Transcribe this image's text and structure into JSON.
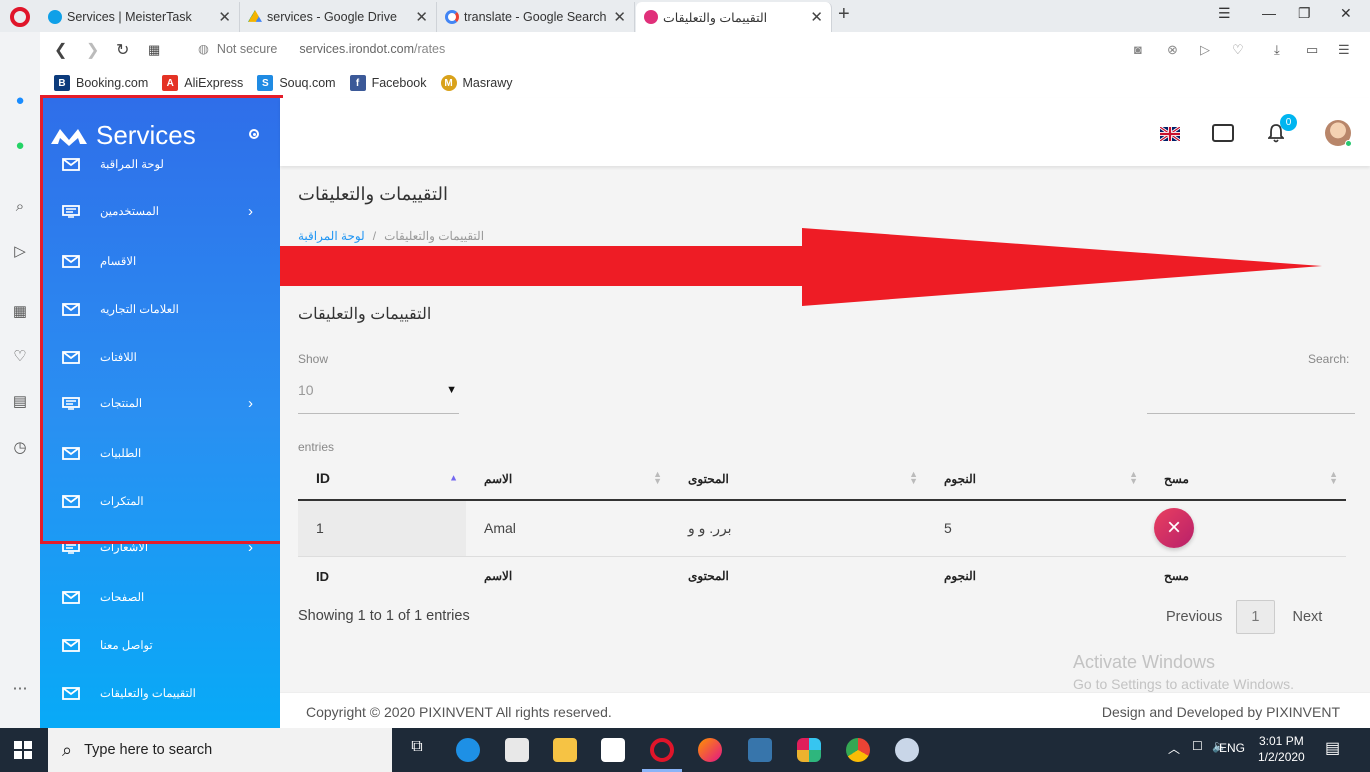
{
  "browser": {
    "tabs": [
      {
        "title": "Services | MeisterTask",
        "color": "#0fa0e8"
      },
      {
        "title": "services - Google Drive",
        "color": "#f4b400"
      },
      {
        "title": "translate - Google Search",
        "color": "#4285f4"
      },
      {
        "title": "التقييمات والتعليقات",
        "color": "#e0307a"
      }
    ],
    "not_secure": "Not secure",
    "url_host": "services.irondot.com",
    "url_path": "/rates",
    "bookmarks": [
      {
        "label": "Booking.com",
        "icon": "B",
        "color": "#0c3b7c"
      },
      {
        "label": "AliExpress",
        "icon": "A",
        "color": "#e43225"
      },
      {
        "label": "Souq.com",
        "icon": "S",
        "color": "#1f8be3"
      },
      {
        "label": "Facebook",
        "icon": "f",
        "color": "#3b5998"
      },
      {
        "label": "Masrawy",
        "icon": "M",
        "color": "#d9a21b"
      }
    ]
  },
  "sidebar": {
    "brand": "Services",
    "items": [
      {
        "label": "لوحة المراقبة",
        "icon": "mail-icon",
        "has_arrow": false
      },
      {
        "label": "المستخدمين",
        "icon": "monitor-icon",
        "has_arrow": true
      },
      {
        "label": "الاقسام",
        "icon": "mail-icon",
        "has_arrow": false
      },
      {
        "label": "العلامات التجاريه",
        "icon": "mail-icon",
        "has_arrow": false
      },
      {
        "label": "اللافتات",
        "icon": "mail-icon",
        "has_arrow": false
      },
      {
        "label": "المنتجات",
        "icon": "monitor-icon",
        "has_arrow": true
      },
      {
        "label": "الطلبيات",
        "icon": "mail-icon",
        "has_arrow": false
      },
      {
        "label": "المتكرات",
        "icon": "mail-icon",
        "has_arrow": false
      },
      {
        "label": "الاشعارات",
        "icon": "monitor-icon",
        "has_arrow": true
      },
      {
        "label": "الصفحات",
        "icon": "mail-icon",
        "has_arrow": false
      },
      {
        "label": "تواصل معنا",
        "icon": "mail-icon",
        "has_arrow": false
      },
      {
        "label": "التقييمات والتعليقات",
        "icon": "mail-icon",
        "has_arrow": false
      }
    ]
  },
  "topnav": {
    "notification_count": "0"
  },
  "page": {
    "title": "التقييمات والتعليقات",
    "breadcrumb_home": "لوحة المراقبة",
    "breadcrumb_separator": "/",
    "breadcrumb_current": "التقييمات والتعليقات",
    "card_title": "التقييمات والتعليقات",
    "show_label": "Show",
    "page_length": "10",
    "entries_label": "entries",
    "search_label": "Search:"
  },
  "table": {
    "columns": [
      "ID",
      "الاسم",
      "المحتوى",
      "النجوم",
      "مسح"
    ],
    "rows": [
      {
        "id": "1",
        "name": "Amal",
        "content": "برر. و و",
        "stars": "5",
        "delete": "×"
      }
    ],
    "info": "Showing 1 to 1 of 1 entries",
    "pagination": {
      "previous": "Previous",
      "current": "1",
      "next": "Next"
    }
  },
  "watermark": {
    "line1": "Activate Windows",
    "line2": "Go to Settings to activate Windows."
  },
  "footer": {
    "copyright": "Copyright © 2020 PIXINVENT All rights reserved.",
    "credit": "Design and Developed by PIXINVENT"
  },
  "taskbar": {
    "search_placeholder": "Type here to search",
    "language": "ENG",
    "time": "3:01 PM",
    "date": "1/2/2020"
  },
  "colors": {
    "sidebar_top": "#2f6ee9",
    "sidebar_bottom": "#08aaf7",
    "annotation_red": "#e41d2a",
    "link_blue": "#2196f3"
  }
}
